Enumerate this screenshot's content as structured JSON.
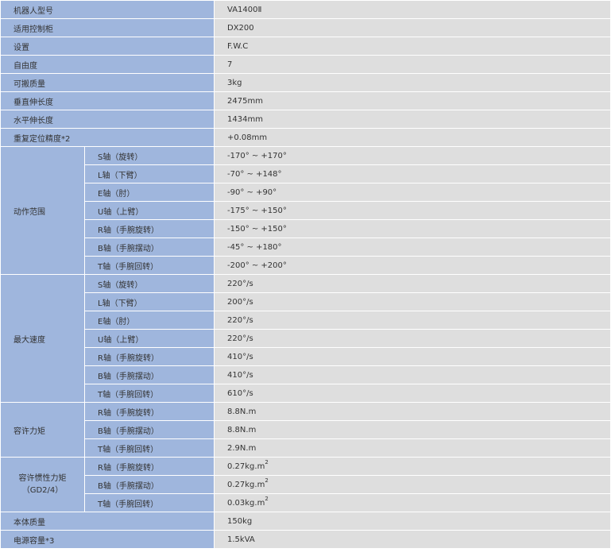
{
  "rows_top": [
    {
      "label": "机器人型号",
      "value": "VA1400Ⅱ"
    },
    {
      "label": "适用控制柜",
      "value": "DX200"
    },
    {
      "label": "设置",
      "value": "F.W.C"
    },
    {
      "label": "自由度",
      "value": "7"
    },
    {
      "label": "可搬质量",
      "value": "3kg"
    },
    {
      "label": "垂直伸长度",
      "value": "2475mm"
    },
    {
      "label": "水平伸长度",
      "value": "1434mm"
    },
    {
      "label": "重复定位精度*2",
      "value": "+0.08mm"
    }
  ],
  "motion_range": {
    "label": "动作范围",
    "items": [
      {
        "axis": "S轴（旋转）",
        "value": "-170° ~ +170°"
      },
      {
        "axis": "L轴（下臂）",
        "value": "-70° ~ +148°"
      },
      {
        "axis": "E轴（肘）",
        "value": "-90° ~ +90°"
      },
      {
        "axis": "U轴（上臂）",
        "value": "-175° ~ +150°"
      },
      {
        "axis": "R轴（手腕旋转）",
        "value": "-150° ~ +150°"
      },
      {
        "axis": "B轴（手腕摆动）",
        "value": "-45° ~ +180°"
      },
      {
        "axis": "T轴（手腕回转）",
        "value": "-200° ~ +200°"
      }
    ]
  },
  "max_speed": {
    "label": "最大速度",
    "items": [
      {
        "axis": "S轴（旋转）",
        "value": "220°/s"
      },
      {
        "axis": "L轴（下臂）",
        "value": "200°/s"
      },
      {
        "axis": "E轴（肘）",
        "value": "220°/s"
      },
      {
        "axis": "U轴（上臂）",
        "value": "220°/s"
      },
      {
        "axis": "R轴（手腕旋转）",
        "value": "410°/s"
      },
      {
        "axis": "B轴（手腕摆动）",
        "value": "410°/s"
      },
      {
        "axis": "T轴（手腕回转）",
        "value": "610°/s"
      }
    ]
  },
  "allowable_moment": {
    "label": "容许力矩",
    "items": [
      {
        "axis": "R轴（手腕旋转）",
        "value": "8.8N.m"
      },
      {
        "axis": "B轴（手腕摆动）",
        "value": "8.8N.m"
      },
      {
        "axis": "T轴（手腕回转）",
        "value": "2.9N.m"
      }
    ]
  },
  "allowable_inertia": {
    "label_line1": "容许惯性力矩",
    "label_line2": "（GD2/4）",
    "superscript": "2",
    "items": [
      {
        "axis": "R轴（手腕旋转）",
        "value": "0.27kg.m"
      },
      {
        "axis": "B轴（手腕摆动）",
        "value": "0.27kg.m"
      },
      {
        "axis": "T轴（手腕回转）",
        "value": "0.03kg.m"
      }
    ]
  },
  "rows_bottom": [
    {
      "label": "本体质量",
      "value": "150kg"
    },
    {
      "label": "电源容量*3",
      "value": "1.5kVA"
    }
  ]
}
